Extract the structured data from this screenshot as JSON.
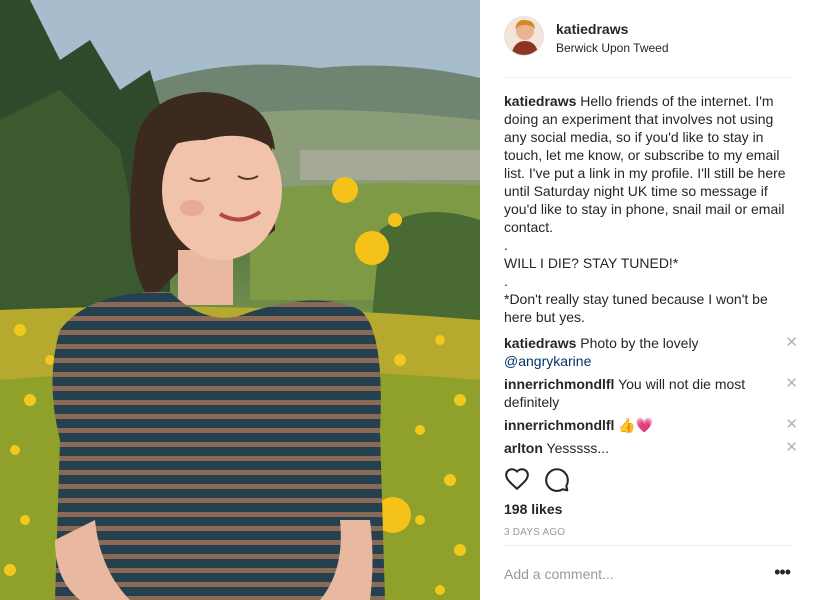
{
  "post": {
    "author": "katiedraws",
    "location": "Berwick Upon Tweed",
    "caption_user": "katiedraws",
    "caption_text": " Hello friends of the internet. I'm doing an experiment that involves not using any social media, so if you'd like to stay in touch, let me know, or subscribe to my email list. I've put a link in my profile. I'll still be here until Saturday night UK time so message if you'd like to stay in phone, snail mail or email contact.\n.\nWILL I DIE? STAY TUNED!*\n.\n*Don't really stay tuned because I won't be here but yes.",
    "comments": [
      {
        "user": "katiedraws",
        "text": " Photo by the lovely ",
        "mention": "@angrykarine"
      },
      {
        "user": "innerrichmondlfl",
        "text": " You will not die most definitely",
        "mention": ""
      },
      {
        "user": "innerrichmondlfl",
        "text": " 👍💗",
        "mention": ""
      },
      {
        "user": "arlton",
        "text": " Yesssss...",
        "mention": ""
      }
    ],
    "remove_glyph": "✕",
    "likes": "198 likes",
    "date": "3 DAYS AGO",
    "add_comment_placeholder": "Add a comment...",
    "more_glyph": "•••"
  },
  "icons": {
    "heart": "heart-icon",
    "comment": "comment-bubble-icon",
    "more": "more-options-icon"
  },
  "colors": {
    "text": "#262626",
    "muted": "#999999",
    "link": "#003569",
    "divider": "#efefef"
  }
}
